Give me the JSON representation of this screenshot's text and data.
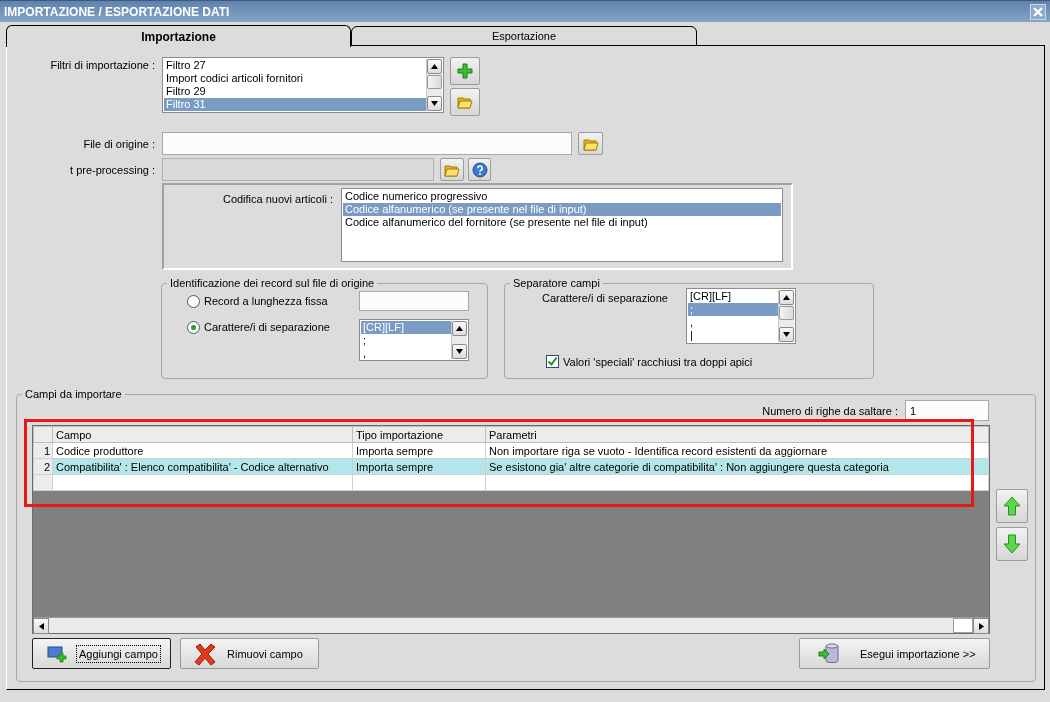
{
  "window": {
    "title": "IMPORTAZIONE / ESPORTAZIONE DATI"
  },
  "tabs": [
    {
      "label": "Importazione",
      "selected": true
    },
    {
      "label": "Esportazione",
      "selected": false
    }
  ],
  "filters": {
    "label": "Filtri di importazione :",
    "items": [
      {
        "label": "Filtro 27",
        "selected": false
      },
      {
        "label": "Import codici articoli fornitori",
        "selected": false
      },
      {
        "label": "Filtro 29",
        "selected": false
      },
      {
        "label": "Filtro 31",
        "selected": true
      }
    ]
  },
  "source_file": {
    "label": "File di origine :"
  },
  "preprocessing": {
    "label": "t pre-processing :",
    "disabled": true
  },
  "new_item_coding": {
    "label": "Codifica nuovi articoli :",
    "items": [
      {
        "label": "Codice numerico progressivo",
        "selected": false
      },
      {
        "label": "Codice alfanumerico (se presente nel file di input)",
        "selected": true
      },
      {
        "label": "Codice alfanumerico del fornitore (se presente nel file di input)",
        "selected": false
      }
    ]
  },
  "record_identification": {
    "title": "Identificazione dei record sul file di origine",
    "options": [
      {
        "label": "Record a lunghezza fissa",
        "selected": false
      },
      {
        "label": "Carattere/i di separazione",
        "selected": true
      }
    ],
    "separators": [
      {
        "label": "[CR][LF]",
        "selected": true
      },
      {
        "label": ";",
        "selected": false
      },
      {
        "label": ",",
        "selected": false
      }
    ]
  },
  "field_separator": {
    "title": "Separatore campi",
    "label": "Carattere/i di separazione",
    "items": [
      {
        "label": "[CR][LF]",
        "selected": false
      },
      {
        "label": ";",
        "selected": true
      },
      {
        "label": ",",
        "selected": false
      },
      {
        "label": "|",
        "selected": false
      }
    ],
    "quoted_values": {
      "label": "Valori 'speciali' racchiusi tra doppi apici",
      "checked": true
    }
  },
  "fields": {
    "title": "Campi da importare",
    "skip_rows": {
      "label": "Numero di righe da saltare :",
      "value": "1"
    },
    "columns": [
      "Campo",
      "Tipo importazione",
      "Parametri"
    ],
    "rows": [
      {
        "number": "1",
        "cells": [
          "Codice produttore",
          "Importa sempre",
          "Non importare riga se vuoto - Identifica record esistenti da aggiornare"
        ],
        "selected": false
      },
      {
        "number": "2",
        "cells": [
          "Compatibilita' : Elenco compatibilita' - Codice alternativo",
          "Importa sempre",
          "Se esistono gia' altre categorie di compatibilita' : Non aggiungere questa categoria"
        ],
        "selected": true
      }
    ]
  },
  "buttons": [
    {
      "label": "Aggiungi campo",
      "kind": "add"
    },
    {
      "label": "Rimuovi campo",
      "kind": "remove"
    },
    {
      "label": "Esegui importazione >>",
      "kind": "run"
    }
  ]
}
